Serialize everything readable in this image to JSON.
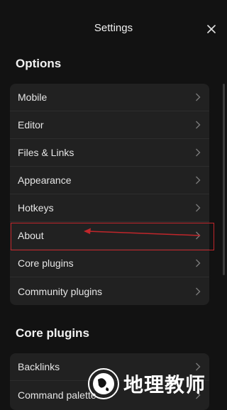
{
  "header": {
    "title": "Settings",
    "close_icon": "close-icon"
  },
  "options": {
    "title": "Options",
    "items": [
      {
        "label": "Mobile"
      },
      {
        "label": "Editor"
      },
      {
        "label": "Files & Links"
      },
      {
        "label": "Appearance"
      },
      {
        "label": "Hotkeys"
      },
      {
        "label": "About"
      },
      {
        "label": "Core plugins"
      },
      {
        "label": "Community plugins"
      }
    ]
  },
  "core_plugins": {
    "title": "Core plugins",
    "items": [
      {
        "label": "Backlinks"
      },
      {
        "label": "Command palette"
      }
    ]
  },
  "annotation": {
    "highlight_color": "#c0262b",
    "highlighted_item": "About"
  },
  "watermark": {
    "text": "地理教师",
    "logo_icon": "globe-logo-icon"
  },
  "colors": {
    "background": "#121212",
    "card": "#212121",
    "accent": "#c0262b"
  }
}
